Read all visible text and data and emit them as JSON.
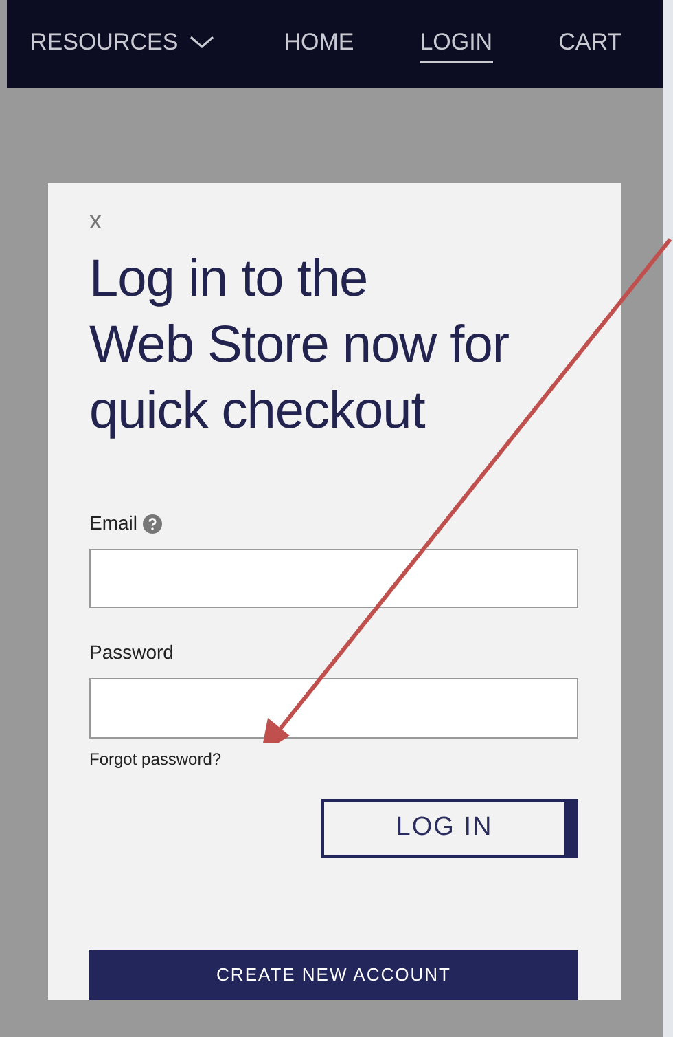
{
  "nav": [
    {
      "label": "RESOURCES",
      "dropdown": true,
      "selected": false
    },
    {
      "label": "HOME",
      "dropdown": false,
      "selected": false
    },
    {
      "label": "LOGIN",
      "dropdown": false,
      "selected": true
    },
    {
      "label": "CART",
      "dropdown": false,
      "selected": false
    }
  ],
  "dialog": {
    "close": "x",
    "title_lines": [
      "Log in to the",
      "Web Store now for",
      "quick checkout"
    ],
    "fields": [
      {
        "label": "Email",
        "help": true
      },
      {
        "label": "Password",
        "help": false
      }
    ],
    "forgot": "Forgot password?",
    "login_button": "LOG IN",
    "create_button": "CREATE NEW ACCOUNT"
  }
}
